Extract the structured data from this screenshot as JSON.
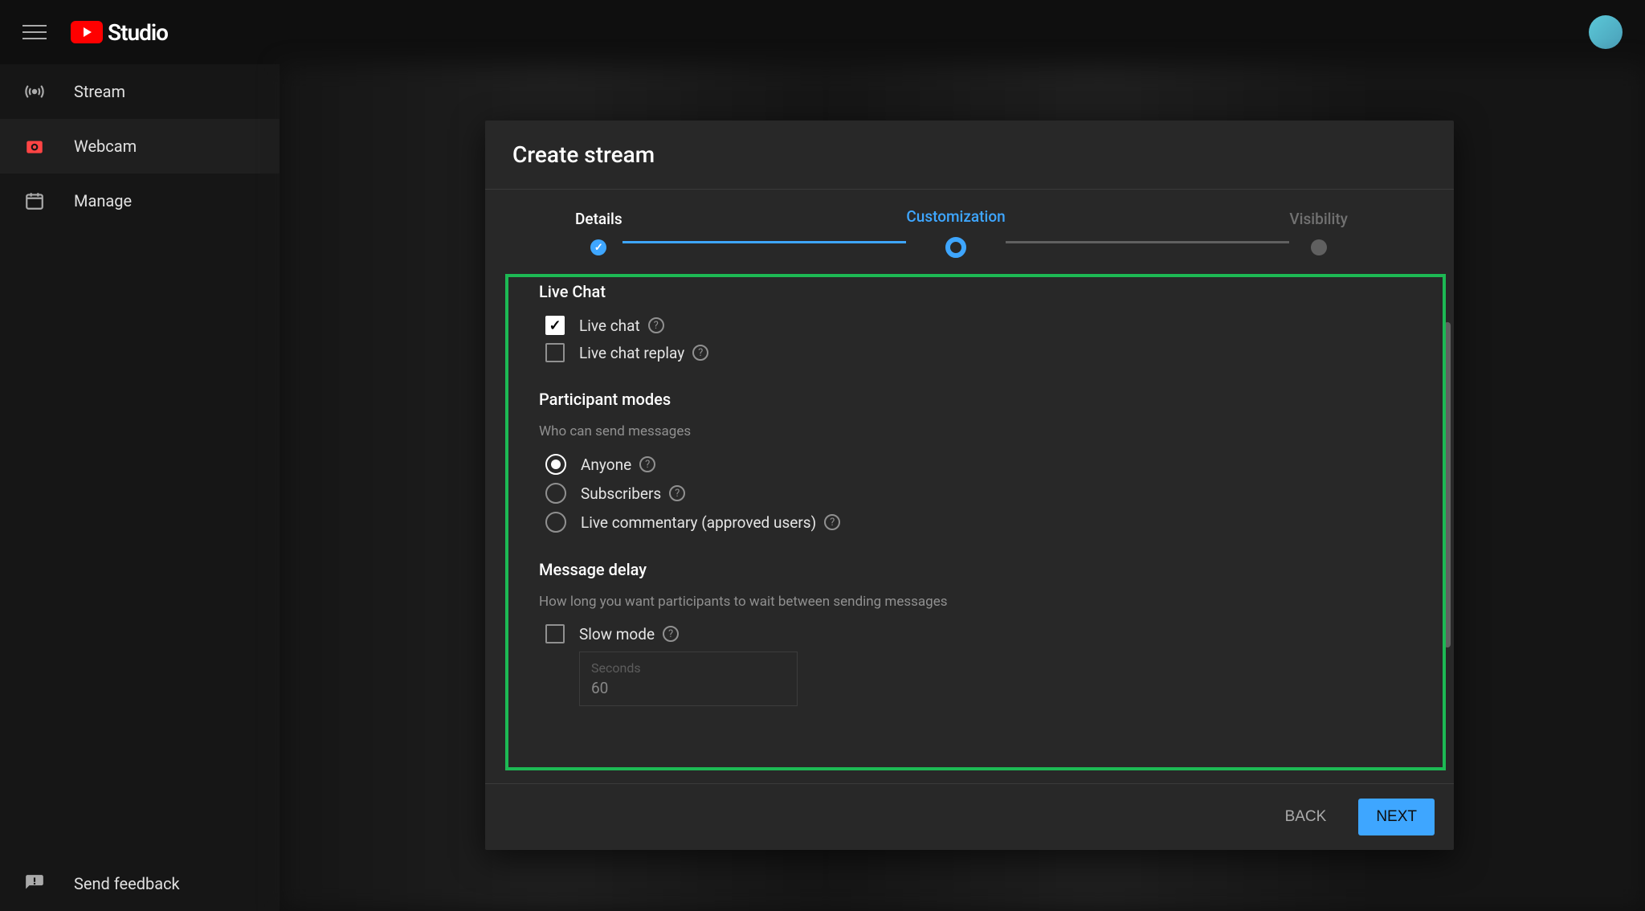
{
  "app": {
    "name": "Studio"
  },
  "sidebar": {
    "items": [
      {
        "label": "Stream",
        "icon": "stream"
      },
      {
        "label": "Webcam",
        "icon": "webcam"
      },
      {
        "label": "Manage",
        "icon": "calendar"
      }
    ],
    "feedback": "Send feedback"
  },
  "modal": {
    "title": "Create stream",
    "steps": [
      {
        "label": "Details",
        "state": "completed"
      },
      {
        "label": "Customization",
        "state": "active"
      },
      {
        "label": "Visibility",
        "state": "pending"
      }
    ],
    "live_chat": {
      "heading": "Live Chat",
      "options": [
        {
          "label": "Live chat",
          "checked": true
        },
        {
          "label": "Live chat replay",
          "checked": false
        }
      ]
    },
    "participant": {
      "heading": "Participant modes",
      "subtext": "Who can send messages",
      "options": [
        {
          "label": "Anyone",
          "checked": true
        },
        {
          "label": "Subscribers",
          "checked": false
        },
        {
          "label": "Live commentary (approved users)",
          "checked": false
        }
      ]
    },
    "delay": {
      "heading": "Message delay",
      "subtext": "How long you want participants to wait between sending messages",
      "slow_mode": {
        "label": "Slow mode",
        "checked": false
      },
      "seconds_label": "Seconds",
      "seconds_value": "60"
    },
    "footer": {
      "back": "BACK",
      "next": "NEXT"
    }
  }
}
